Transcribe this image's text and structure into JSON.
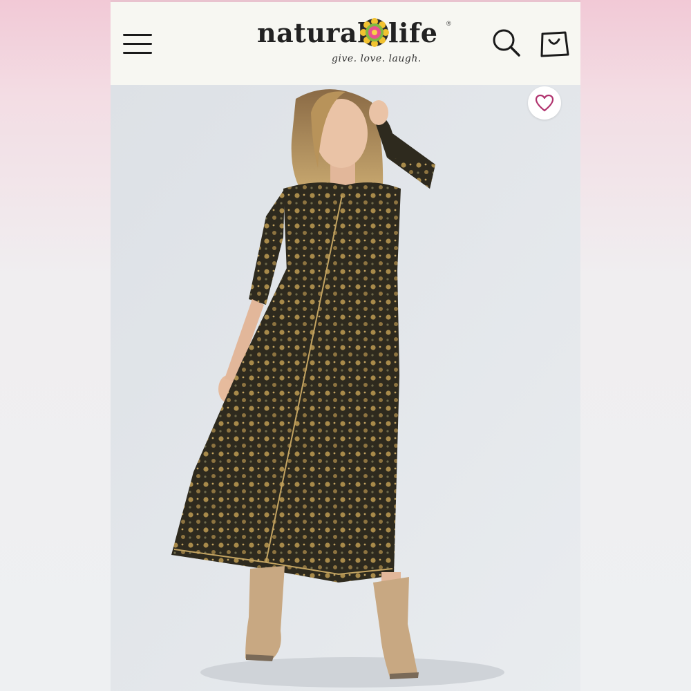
{
  "header": {
    "menu_icon": "hamburger-menu-icon",
    "logo": {
      "word_left": "natural",
      "word_right": "life",
      "registered": "®",
      "tagline": "give. love. laugh."
    },
    "search_icon": "search-icon",
    "cart_icon": "shopping-bag-icon"
  },
  "product": {
    "image_alt": "Model wearing long-sleeve printed maxi dress with tan cowboy boots",
    "favorite_icon": "heart-icon"
  },
  "colors": {
    "accent": "#b0336e",
    "header_bg": "#f7f7f2",
    "page_bg": "#dfe3e8",
    "dress": "#2e2a1e",
    "print": "#a88a4a",
    "boots": "#c8a882"
  }
}
